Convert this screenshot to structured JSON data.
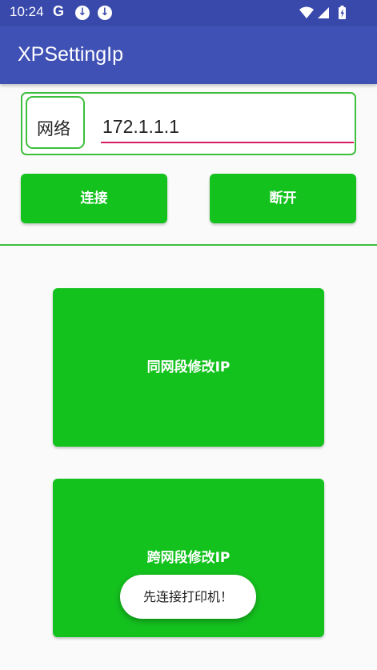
{
  "status_bar": {
    "time": "10:24",
    "g_icon": "G",
    "download_icon_1": "↓",
    "download_icon_2": "↓",
    "icons": [
      "wifi-icon",
      "signal-icon",
      "battery-icon"
    ]
  },
  "app_bar": {
    "title": "XPSettingIp"
  },
  "network": {
    "label": "网络",
    "ip_value": "172.1.1.1"
  },
  "buttons": {
    "connect": "连接",
    "disconnect": "断开",
    "same_segment": "同网段修改IP",
    "cross_segment": "跨网段修改IP"
  },
  "toast": {
    "message": "先连接打印机！"
  },
  "colors": {
    "status_bar": "#3949ab",
    "app_bar": "#3f51b5",
    "button_green": "#14c21e",
    "border_green": "#3cc03c",
    "input_underline": "#d81b60"
  }
}
